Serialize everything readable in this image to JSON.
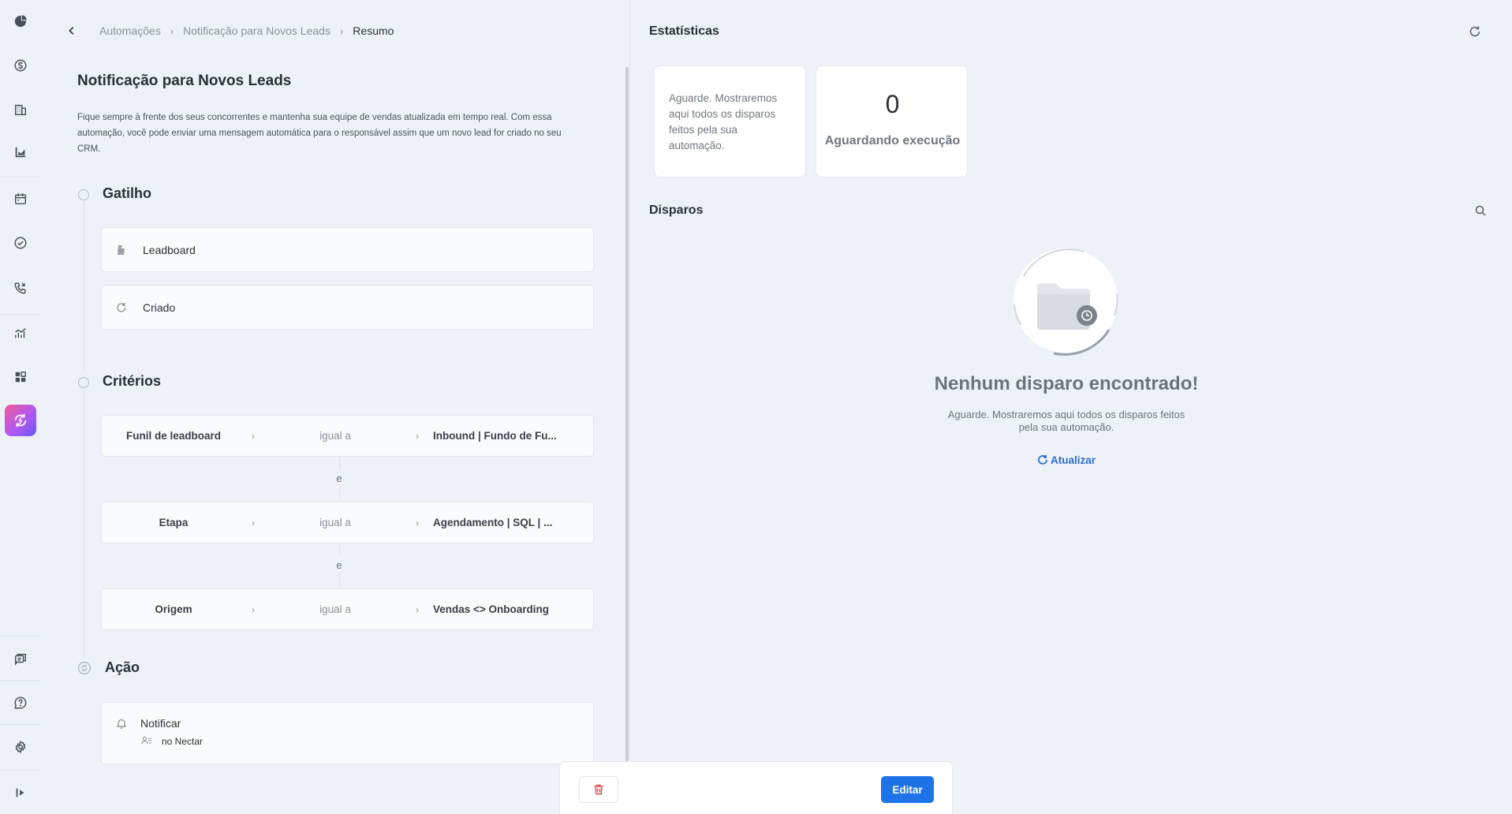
{
  "breadcrumb": {
    "items": [
      "Automações",
      "Notificação para Novos Leads"
    ],
    "current": "Resumo"
  },
  "automation": {
    "title": "Notificação para Novos Leads",
    "description": "Fique sempre à frente dos seus concorrentes e mantenha sua equipe de vendas atualizada em tempo real. Com essa automação, você pode enviar uma mensagem automática para o responsável assim que um novo lead for criado no seu CRM."
  },
  "trigger": {
    "title": "Gatilho",
    "items": [
      {
        "label": "Leadboard",
        "icon": "leadboard-icon"
      },
      {
        "label": "Criado",
        "icon": "refresh-icon"
      }
    ]
  },
  "criteria": {
    "title": "Critérios",
    "conjunction": "e",
    "rows": [
      {
        "field": "Funil de leadboard",
        "operator": "igual a",
        "value": "Inbound | Fundo de Fu..."
      },
      {
        "field": "Etapa",
        "operator": "igual a",
        "value": "Agendamento | SQL | ..."
      },
      {
        "field": "Origem",
        "operator": "igual a",
        "value": "Vendas <> Onboarding"
      }
    ]
  },
  "action": {
    "title": "Ação",
    "name": "Notificar",
    "target": "no Nectar"
  },
  "stats": {
    "title": "Estatísticas",
    "info_text": "Aguarde. Mostraremos aqui todos os disparos feitos pela sua automação.",
    "count": "0",
    "count_label": "Aguardando execução"
  },
  "disparos": {
    "title": "Disparos",
    "empty_title": "Nenhum disparo encontrado!",
    "empty_desc": "Aguarde. Mostraremos aqui todos os disparos feitos pela sua automação.",
    "refresh_label": "Atualizar"
  },
  "footer": {
    "edit_label": "Editar"
  },
  "colors": {
    "accent": "#1e73e8",
    "danger": "#e5484d",
    "background": "#eef1f7"
  }
}
